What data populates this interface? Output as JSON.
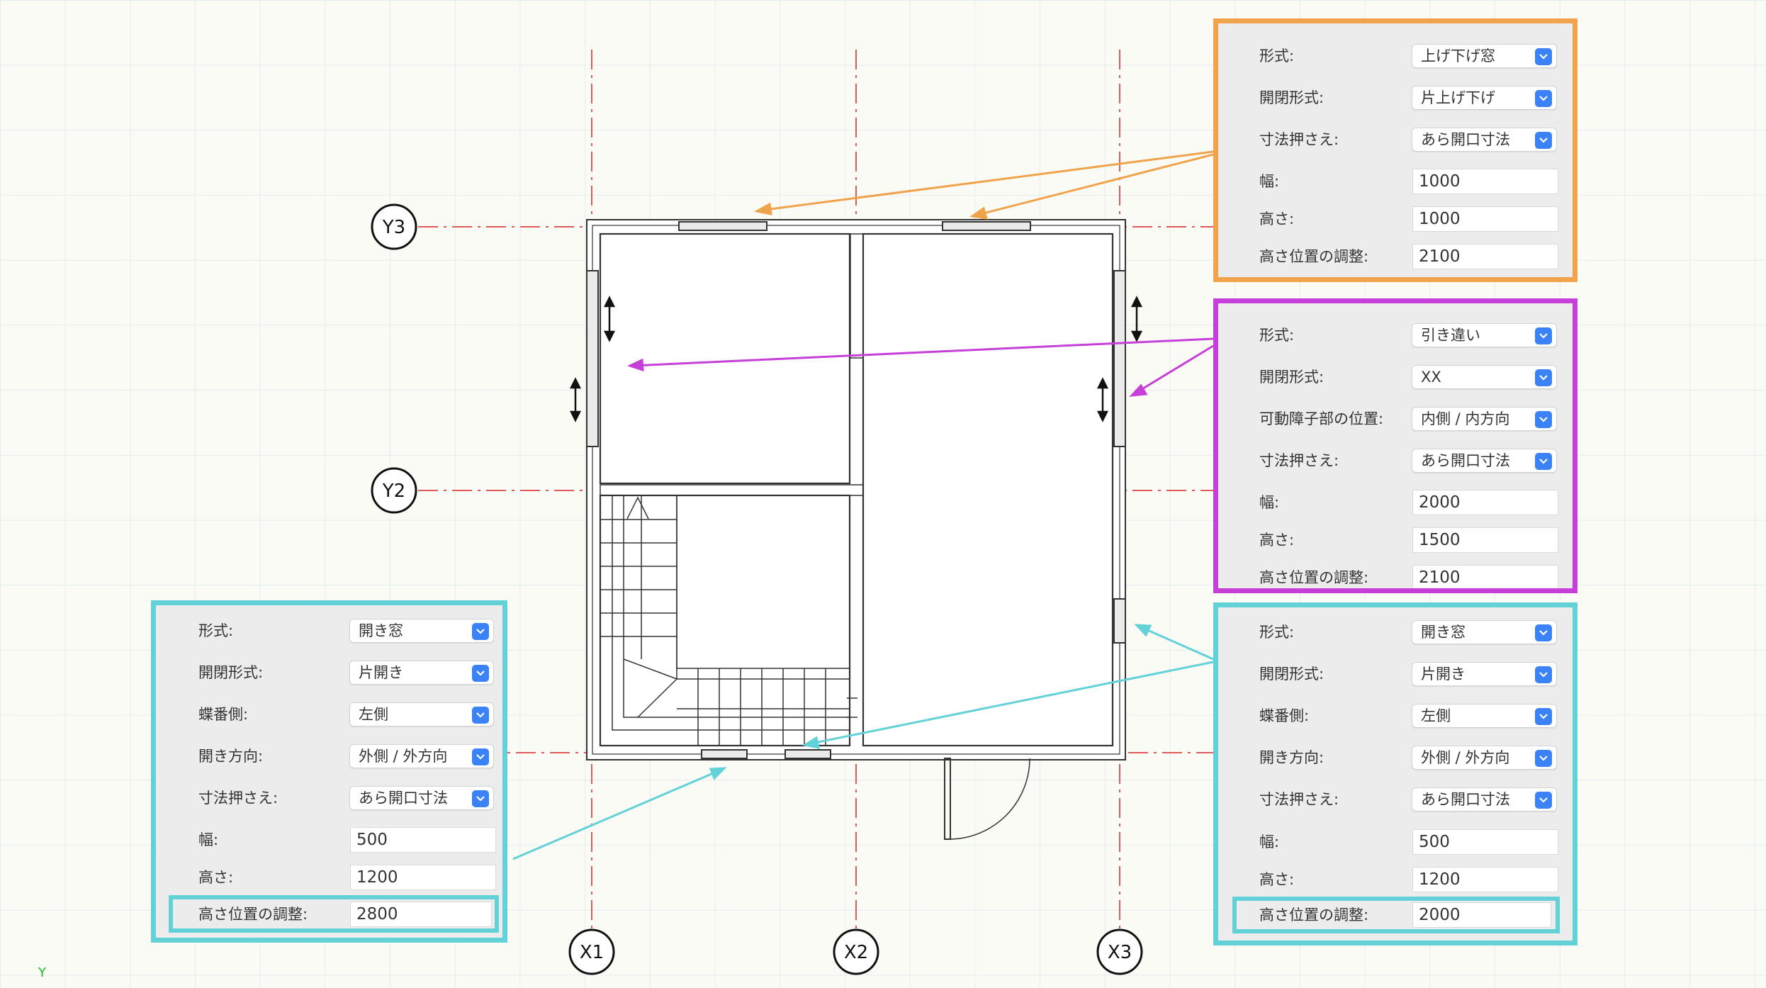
{
  "grid_labels": {
    "x": [
      "X1",
      "X2",
      "X3"
    ],
    "y": [
      "Y3",
      "Y2"
    ]
  },
  "axis_label": "Y",
  "colors": {
    "orange": "#f0a34a",
    "magenta": "#c53fd8",
    "cyan": "#62d1d8",
    "grid_red": "#e05a5a",
    "select_blue": "#3b82f6"
  },
  "panels": {
    "top_right": {
      "rows": [
        {
          "label": "形式:",
          "value": "上げ下げ窓",
          "kind": "select"
        },
        {
          "label": "開閉形式:",
          "value": "片上げ下げ",
          "kind": "select"
        },
        {
          "label": "寸法押さえ:",
          "value": "あら開口寸法",
          "kind": "select"
        },
        {
          "label": "幅:",
          "value": "1000",
          "kind": "input"
        },
        {
          "label": "高さ:",
          "value": "1000",
          "kind": "input"
        },
        {
          "label": "高さ位置の調整:",
          "value": "2100",
          "kind": "input"
        }
      ]
    },
    "middle_right": {
      "rows": [
        {
          "label": "形式:",
          "value": "引き違い",
          "kind": "select"
        },
        {
          "label": "開閉形式:",
          "value": "XX",
          "kind": "select"
        },
        {
          "label": "可動障子部の位置:",
          "value": "内側 / 内方向",
          "kind": "select"
        },
        {
          "label": "寸法押さえ:",
          "value": "あら開口寸法",
          "kind": "select"
        },
        {
          "label": "幅:",
          "value": "2000",
          "kind": "input"
        },
        {
          "label": "高さ:",
          "value": "1500",
          "kind": "input"
        },
        {
          "label": "高さ位置の調整:",
          "value": "2100",
          "kind": "input"
        }
      ]
    },
    "bottom_right": {
      "rows": [
        {
          "label": "形式:",
          "value": "開き窓",
          "kind": "select"
        },
        {
          "label": "開閉形式:",
          "value": "片開き",
          "kind": "select"
        },
        {
          "label": "蝶番側:",
          "value": "左側",
          "kind": "select"
        },
        {
          "label": "開き方向:",
          "value": "外側 / 外方向",
          "kind": "select"
        },
        {
          "label": "寸法押さえ:",
          "value": "あら開口寸法",
          "kind": "select"
        },
        {
          "label": "幅:",
          "value": "500",
          "kind": "input"
        },
        {
          "label": "高さ:",
          "value": "1200",
          "kind": "input"
        },
        {
          "label": "高さ位置の調整:",
          "value": "2000",
          "kind": "input"
        }
      ]
    },
    "bottom_left": {
      "rows": [
        {
          "label": "形式:",
          "value": "開き窓",
          "kind": "select"
        },
        {
          "label": "開閉形式:",
          "value": "片開き",
          "kind": "select"
        },
        {
          "label": "蝶番側:",
          "value": "左側",
          "kind": "select"
        },
        {
          "label": "開き方向:",
          "value": "外側 / 外方向",
          "kind": "select"
        },
        {
          "label": "寸法押さえ:",
          "value": "あら開口寸法",
          "kind": "select"
        },
        {
          "label": "幅:",
          "value": "500",
          "kind": "input"
        },
        {
          "label": "高さ:",
          "value": "1200",
          "kind": "input"
        },
        {
          "label": "高さ位置の調整:",
          "value": "2800",
          "kind": "input"
        }
      ]
    }
  }
}
